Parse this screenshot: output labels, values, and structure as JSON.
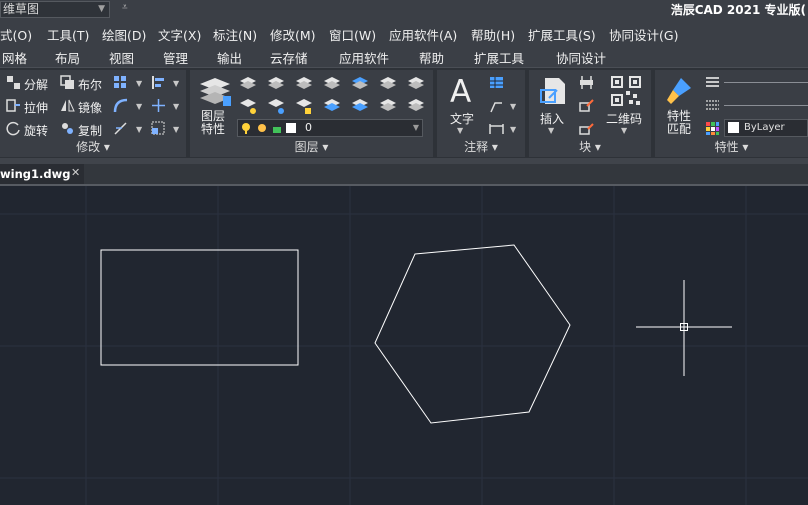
{
  "titlebar": {
    "workspace": "维草图",
    "qa_glyph": "⩡",
    "app_title": "浩辰CAD 2021 专业版("
  },
  "menu": [
    "式(O)",
    "工具(T)",
    "绘图(D)",
    "文字(X)",
    "标注(N)",
    "修改(M)",
    "窗口(W)",
    "应用软件(A)",
    "帮助(H)",
    "扩展工具(S)",
    "协同设计(G)"
  ],
  "tabs": [
    "网格",
    "布局",
    "视图",
    "管理",
    "输出",
    "云存储",
    "应用软件",
    "帮助",
    "扩展工具",
    "协同设计"
  ],
  "ribbon": {
    "modify": {
      "label": "修改",
      "tools": [
        "分解",
        "布尔",
        "拉伸",
        "镜像",
        "旋转",
        "复制"
      ]
    },
    "layers": {
      "label": "图层",
      "big_button": [
        "图层",
        "特性"
      ],
      "current_layer": "0"
    },
    "annotation": {
      "label": "注释",
      "text_button": "文字",
      "big_glyph": "A"
    },
    "block": {
      "label": "块",
      "insert_button": "插入",
      "qr_button": "二维码"
    },
    "properties": {
      "label": "特性",
      "match_button": [
        "特性",
        "匹配"
      ],
      "bylayer": "ByLayer"
    }
  },
  "document": {
    "tab_label": "wing1.dwg",
    "close_glyph": "✕"
  },
  "colors": {
    "canvas": "#212630",
    "ribbon": "#3a3e45",
    "menubar": "#3b3f46",
    "entity": "#ffffff"
  }
}
